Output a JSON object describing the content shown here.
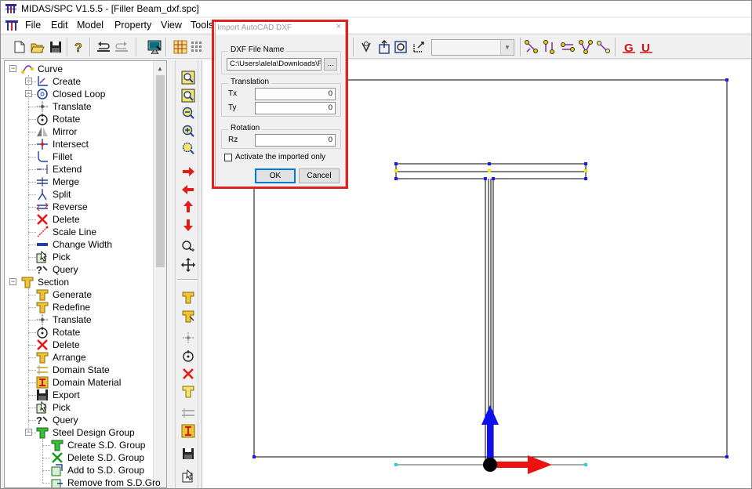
{
  "app": {
    "title": "MIDAS/SPC V1.5.5 - [Filler Beam_dxf.spc]"
  },
  "menu": [
    "File",
    "Edit",
    "Model",
    "Property",
    "View",
    "Tools"
  ],
  "toolbar": {
    "icons": [
      "new-icon",
      "open-icon",
      "save-icon",
      "help-icon",
      "undo-icon",
      "redo-icon",
      "mesh-view-icon",
      "grid-icon",
      "dots-grid-icon",
      "check-icon",
      "section-a-icon",
      "section-b-icon",
      "axis-icon",
      "node-move-icon",
      "node-copy-icon",
      "node-swap-icon",
      "node-group-icon",
      "node-select-icon",
      "g-display-icon",
      "u-display-icon"
    ],
    "combo_value": ""
  },
  "tree": {
    "curve": {
      "label": "Curve",
      "items": [
        "Create",
        "Closed Loop",
        "Translate",
        "Rotate",
        "Mirror",
        "Intersect",
        "Fillet",
        "Extend",
        "Merge",
        "Split",
        "Reverse",
        "Delete",
        "Scale Line",
        "Change Width",
        "Pick",
        "Query"
      ]
    },
    "section": {
      "label": "Section",
      "items": [
        "Generate",
        "Redefine",
        "Translate",
        "Rotate",
        "Delete",
        "Arrange",
        "Domain State",
        "Domain Material",
        "Export",
        "Pick",
        "Query"
      ]
    },
    "sdgroup": {
      "label": "Steel Design Group",
      "items": [
        "Create S.D. Group",
        "Delete S.D. Group",
        "Add to S.D. Group",
        "Remove from S.D.Gro"
      ]
    }
  },
  "dialog": {
    "title": "Import AutoCAD DXF",
    "close": "×",
    "file_group": "DXF File Name",
    "file_path": "C:\\Users\\alela\\Downloads\\Fil",
    "browse": "...",
    "translation_group": "Translation",
    "tx_label": "Tx",
    "tx_value": "0",
    "ty_label": "Ty",
    "ty_value": "0",
    "rotation_group": "Rotation",
    "rz_label": "Rz",
    "rz_value": "0",
    "activate_label": "Activate the imported only",
    "activate_checked": false,
    "ok": "OK",
    "cancel": "Cancel"
  },
  "colors": {
    "highlight": "#e0211f",
    "axis_x": "#ee1111",
    "axis_y": "#1010ee",
    "node": "#1a1aee",
    "node_yellow": "#f4e20a"
  }
}
